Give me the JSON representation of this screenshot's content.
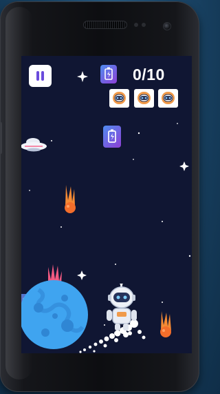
{
  "hud": {
    "pause_label": "",
    "score_text": "0/10",
    "lives": [
      {
        "name": "robot-life-1"
      },
      {
        "name": "robot-life-2"
      },
      {
        "name": "robot-life-3"
      }
    ]
  },
  "icons": {
    "pause": "pause-icon",
    "battery": "battery-icon",
    "robot": "robot-icon",
    "ufo": "ufo-icon",
    "meteor": "meteor-icon",
    "planet": "planet-icon"
  },
  "colors": {
    "space": "#101633",
    "accent_purple": "#6a4bdc",
    "battery_gradient_start": "#4f8cf0",
    "battery_gradient_end": "#8e3fd6",
    "meteor": "#f0883c",
    "meteor_pink": "#f25a82",
    "planet": "#3fa4f0"
  }
}
